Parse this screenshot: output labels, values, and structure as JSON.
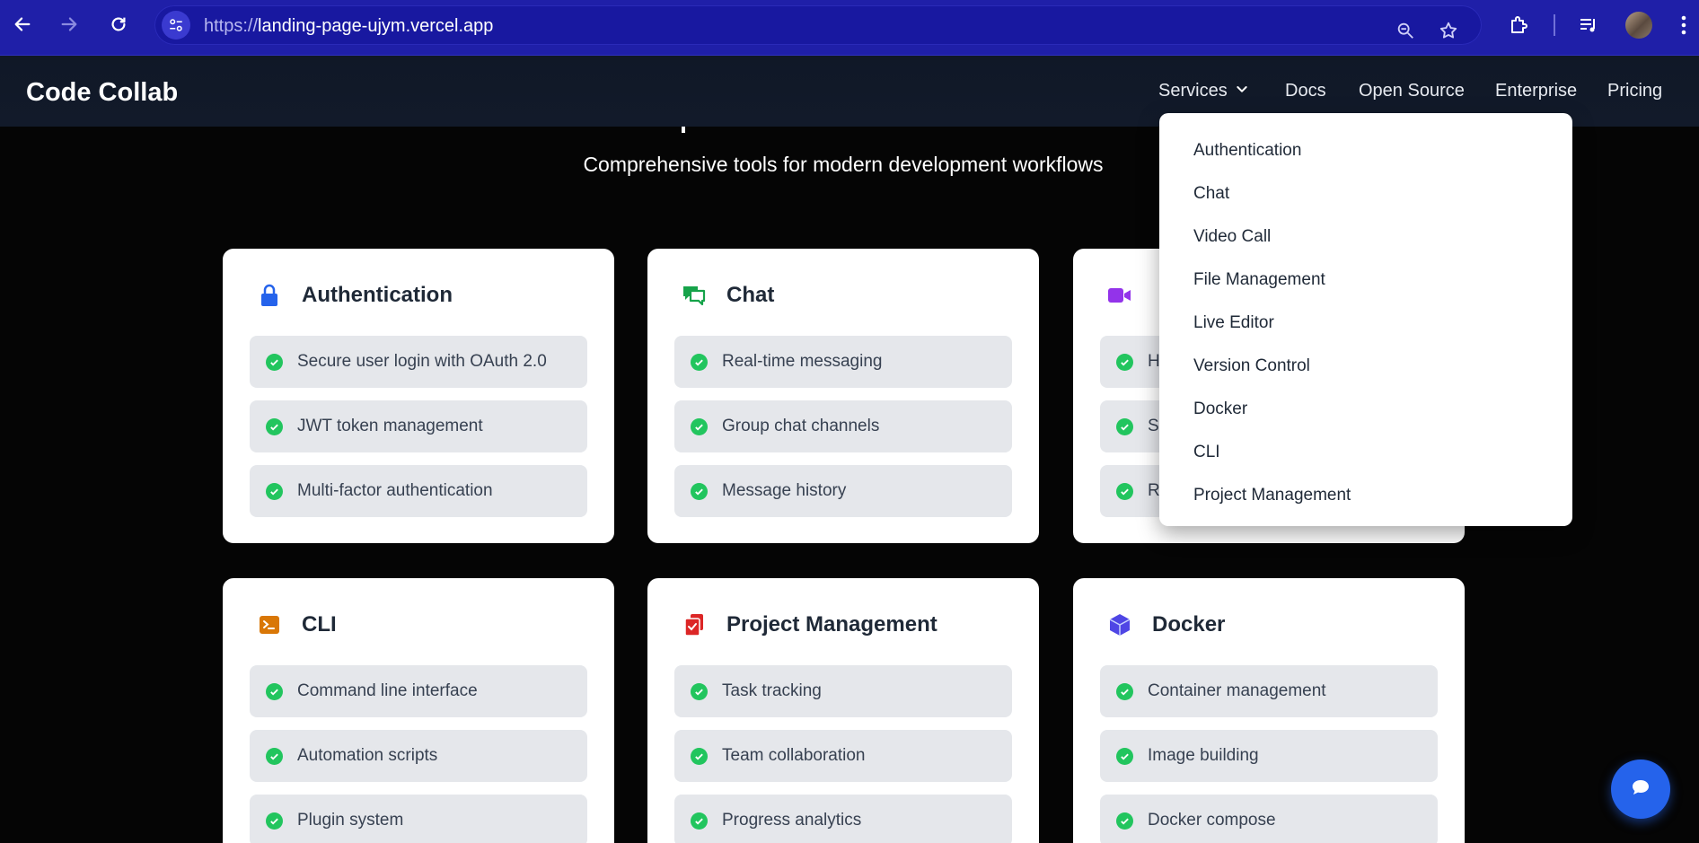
{
  "browser": {
    "url_protocol": "https://",
    "url_host": "landing-page-ujym.vercel.app"
  },
  "site": {
    "brand": "Code Collab",
    "nav": {
      "services": "Services",
      "docs": "Docs",
      "open_source": "Open Source",
      "enterprise": "Enterprise",
      "pricing": "Pricing"
    }
  },
  "hero": {
    "subtitle": "Comprehensive tools for modern development workflows"
  },
  "dropdown": {
    "items": [
      "Authentication",
      "Chat",
      "Video Call",
      "File Management",
      "Live Editor",
      "Version Control",
      "Docker",
      "CLI",
      "Project Management"
    ]
  },
  "cards": [
    {
      "title": "Authentication",
      "icon": "lock-icon",
      "color": "#2563eb",
      "features": [
        "Secure user login with OAuth 2.0",
        "JWT token management",
        "Multi-factor authentication"
      ]
    },
    {
      "title": "Chat",
      "icon": "chat-bubbles-icon",
      "color": "#16a34a",
      "features": [
        "Real-time messaging",
        "Group chat channels",
        "Message history"
      ]
    },
    {
      "title": "",
      "icon": "video-camera-icon",
      "color": "#9333ea",
      "features": [
        "H",
        "S",
        "R"
      ]
    },
    {
      "title": "CLI",
      "icon": "terminal-icon",
      "color": "#d97706",
      "features": [
        "Command line interface",
        "Automation scripts",
        "Plugin system"
      ]
    },
    {
      "title": "Project Management",
      "icon": "tasks-icon",
      "color": "#dc2626",
      "features": [
        "Task tracking",
        "Team collaboration",
        "Progress analytics"
      ]
    },
    {
      "title": "Docker",
      "icon": "cube-icon",
      "color": "#4f46e5",
      "features": [
        "Container management",
        "Image building",
        "Docker compose"
      ]
    }
  ]
}
